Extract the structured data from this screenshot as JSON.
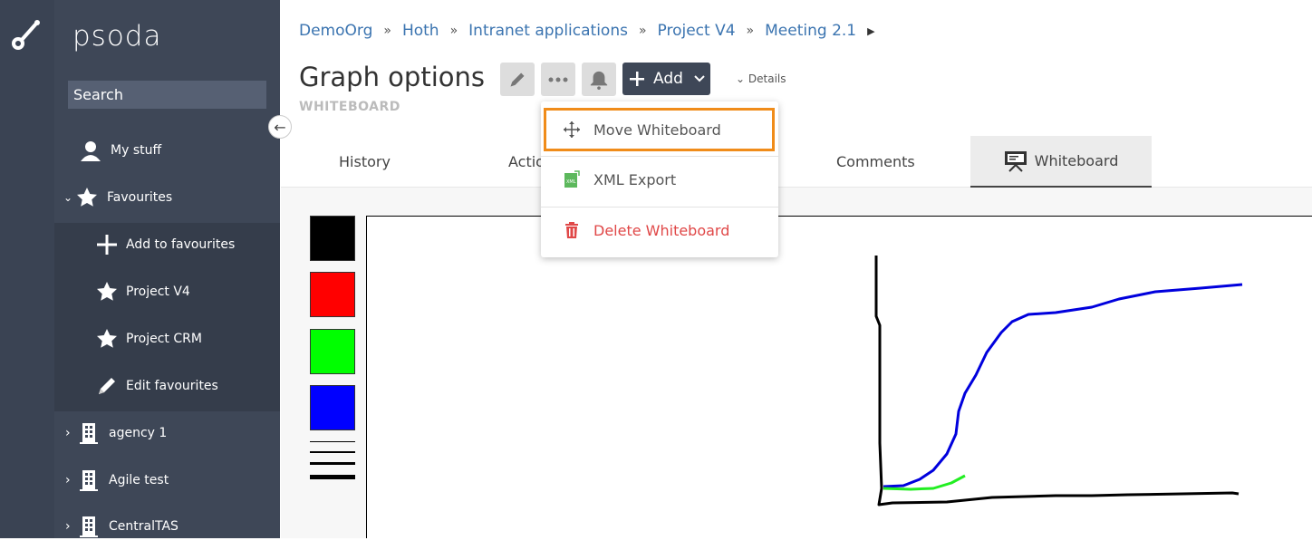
{
  "brand": "psoda",
  "search": {
    "placeholder": "Search"
  },
  "sidebar": {
    "items": [
      {
        "label": "My stuff",
        "icon": "user-icon"
      },
      {
        "label": "Favourites",
        "icon": "star-icon"
      },
      {
        "label": "Add to favourites",
        "icon": "plus-icon"
      },
      {
        "label": "Project V4",
        "icon": "star-icon"
      },
      {
        "label": "Project CRM",
        "icon": "star-icon"
      },
      {
        "label": "Edit favourites",
        "icon": "pencil-icon"
      },
      {
        "label": "agency 1",
        "icon": "building-icon"
      },
      {
        "label": "Agile test",
        "icon": "building-icon"
      },
      {
        "label": "CentralTAS",
        "icon": "building-icon"
      }
    ]
  },
  "breadcrumb": [
    "DemoOrg",
    "Hoth",
    "Intranet applications",
    "Project V4",
    "Meeting 2.1"
  ],
  "breadcrumb_sep": "»",
  "page": {
    "title": "Graph options",
    "subtitle": "WHITEBOARD"
  },
  "toolbar": {
    "add_label": "Add",
    "details_label": "Details"
  },
  "tabs": [
    "History",
    "Actio",
    "Comments",
    "Whiteboard"
  ],
  "dropdown": {
    "items": [
      {
        "label": "Move Whiteboard",
        "icon": "move-icon"
      },
      {
        "label": "XML Export",
        "icon": "xml-icon"
      },
      {
        "label": "Delete Whiteboard",
        "icon": "trash-icon"
      }
    ]
  },
  "colors": {
    "accent": "#3b74b0",
    "sidebar": "#3e4757",
    "highlight": "#f08c1a",
    "delete": "#e04848",
    "swatches": [
      "#000000",
      "#ff0000",
      "#00ff00",
      "#0000ff"
    ]
  }
}
